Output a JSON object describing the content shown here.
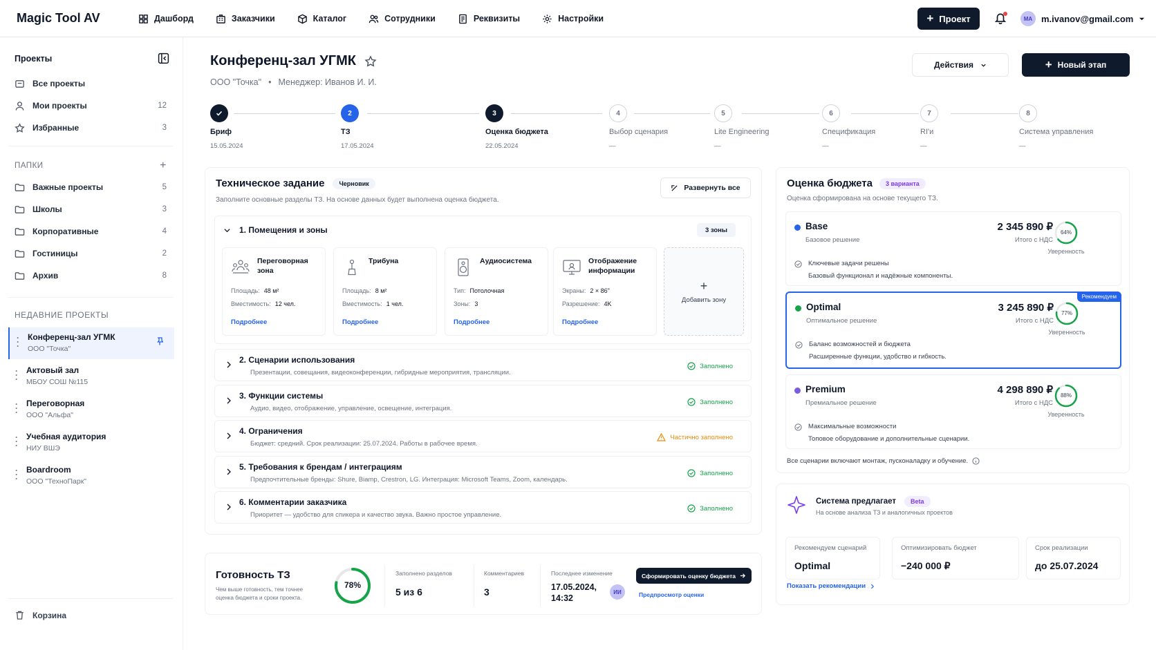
{
  "app": {
    "name": "Magic Tool AV"
  },
  "nav": [
    {
      "label": "Дашборд",
      "icon": "dashboard-icon"
    },
    {
      "label": "Заказчики",
      "icon": "building-icon"
    },
    {
      "label": "Каталог",
      "icon": "box-icon"
    },
    {
      "label": "Сотрудники",
      "icon": "users-icon"
    },
    {
      "label": "Реквизиты",
      "icon": "document-icon"
    },
    {
      "label": "Настройки",
      "icon": "gear-icon"
    }
  ],
  "header": {
    "project_button": "Проект",
    "user_initials": "MA",
    "user_email": "m.ivanov@gmail.com"
  },
  "sidebar": {
    "title": "Проекты",
    "items": [
      {
        "label": "Все проекты",
        "count": ""
      },
      {
        "label": "Мои проекты",
        "count": "12"
      },
      {
        "label": "Избранные",
        "count": "3"
      }
    ],
    "folders_title": "ПАПКИ",
    "folders": [
      {
        "label": "Важные проекты",
        "count": "5"
      },
      {
        "label": "Школы",
        "count": "3"
      },
      {
        "label": "Корпоративные",
        "count": "4"
      },
      {
        "label": "Гостиницы",
        "count": "2"
      },
      {
        "label": "Архив",
        "count": "8"
      }
    ],
    "recent_title": "НЕДАВНИЕ ПРОЕКТЫ",
    "recent": [
      {
        "title": "Конференц-зал УГМК",
        "sub": "ООО \"Точка\""
      },
      {
        "title": "Актовый зал",
        "sub": "МБОУ СОШ №115"
      },
      {
        "title": "Переговорная",
        "sub": "ООО \"Альфа\""
      },
      {
        "title": "Учебная аудитория",
        "sub": "НИУ ВШЭ"
      },
      {
        "title": "Boardroom",
        "sub": "ООО \"ТехноПарк\""
      }
    ],
    "trash": "Корзина"
  },
  "project": {
    "title": "Конференц-зал УГМК",
    "company": "ООО \"Точка\"",
    "separator": "•",
    "manager": "Менеджер: Иванов И. И.",
    "actions_label": "Действия",
    "new_stage_label": "Новый этап"
  },
  "steps": [
    {
      "num": "",
      "label": "Бриф",
      "date": "15.05.2024",
      "state": "done"
    },
    {
      "num": "2",
      "label": "ТЗ",
      "date": "17.05.2024",
      "state": "current"
    },
    {
      "num": "3",
      "label": "Оценка бюджета",
      "date": "22.05.2024",
      "state": "active"
    },
    {
      "num": "4",
      "label": "Выбор сценария",
      "date": "—",
      "state": "todo"
    },
    {
      "num": "5",
      "label": "Lite Engineering",
      "date": "—",
      "state": "todo"
    },
    {
      "num": "6",
      "label": "Спецификация",
      "date": "—",
      "state": "todo"
    },
    {
      "num": "7",
      "label": "RI'и",
      "date": "—",
      "state": "todo"
    },
    {
      "num": "8",
      "label": "Система управления",
      "date": "—",
      "state": "todo"
    }
  ],
  "tz": {
    "title": "Техническое задание",
    "badge": "Черновик",
    "desc": "Заполните основные разделы ТЗ. На основе данных будет выполнена оценка бюджета.",
    "expand_label": "Развернуть все",
    "zones_title": "1.  Помещения и зоны",
    "zones_count": "3 зоны",
    "zones": [
      {
        "title": "Переговорная зона",
        "k1": "Площадь:",
        "v1": "48 м²",
        "k2": "Вместимость:",
        "v2": "12 чел.",
        "more": "Подробнее"
      },
      {
        "title": "Трибуна",
        "k1": "Площадь:",
        "v1": "8 м²",
        "k2": "Вместимость:",
        "v2": "1 чел.",
        "more": "Подробнее"
      },
      {
        "title": "Аудиосистема",
        "k1": "Тип:",
        "v1": "Потолочная",
        "k2": "Зоны:",
        "v2": "3",
        "more": "Подробнее"
      },
      {
        "title": "Отображение информации",
        "k1": "Экраны:",
        "v1": "2 × 86\"",
        "k2": "Разрешение:",
        "v2": "4K",
        "more": "Подробнее"
      }
    ],
    "add_zone": "Добавить зону",
    "sections": [
      {
        "title": "2.  Сценарии использования",
        "desc": "Презентации, совещания, видеоконференции, гибридные мероприятия, трансляции.",
        "status": "Заполнено",
        "kind": "ok"
      },
      {
        "title": "3.  Функции системы",
        "desc": "Аудио, видео, отображение, управление, освещение, интеграция.",
        "status": "Заполнено",
        "kind": "ok"
      },
      {
        "title": "4.  Ограничения",
        "desc": "Бюджет: средний. Срок реализации: 25.07.2024. Работы в рабочее время.",
        "status": "Частично заполнено",
        "kind": "warn"
      },
      {
        "title": "5.  Требования к брендам / интеграциям",
        "desc": "Предпочтительные бренды: Shure, Biamp, Crestron, LG. Интеграция: Microsoft Teams, Zoom, календарь.",
        "status": "Заполнено",
        "kind": "ok"
      },
      {
        "title": "6.  Комментарии заказчика",
        "desc": "Приоритет — удобство для спикера и качество звука. Важно простое управление.",
        "status": "Заполнено",
        "kind": "ok"
      }
    ]
  },
  "readiness": {
    "title": "Готовность ТЗ",
    "desc1": "Чем выше готовность, тем точнее",
    "desc2": "оценка бюджета и сроки проекта.",
    "percent": 78,
    "percent_label": "78%",
    "sections_label": "Заполнено разделов",
    "sections_value": "5 из 6",
    "comments_label": "Комментариев",
    "comments_value": "3",
    "last_label": "Последнее изменение",
    "last_value1": "17.05.2024,",
    "last_value2": "14:32",
    "last_initials": "ИИ",
    "cta": "Сформировать оценку бюджета",
    "preview": "Предпросмотр оценки"
  },
  "budget": {
    "title": "Оценка бюджета",
    "badge": "3 варианта",
    "desc": "Оценка сформирована на основе текущего ТЗ.",
    "recommended": "Рекомендуем",
    "confidence_label": "Уверенность",
    "vat_label": "Итого с НДС",
    "variants": [
      {
        "name": "Base",
        "sub": "Базовое решение",
        "price": "2 345 890 ₽",
        "conf": 64,
        "conf_label": "64%",
        "f1": "Ключевые задачи решены",
        "f2": "Базовый функционал и надёжные компоненты.",
        "color": "#2563eb"
      },
      {
        "name": "Optimal",
        "sub": "Оптимальное решение",
        "price": "3 245 890 ₽",
        "conf": 77,
        "conf_label": "77%",
        "f1": "Баланс возможностей и бюджета",
        "f2": "Расширенные функции, удобство и гибкость.",
        "color": "#16a34a"
      },
      {
        "name": "Premium",
        "sub": "Премиальное решение",
        "price": "4 298 890 ₽",
        "conf": 88,
        "conf_label": "88%",
        "f1": "Максимальные возможности",
        "f2": "Топовое оборудование и дополнительные сценарии.",
        "color": "#7c5ce0"
      }
    ],
    "note": "Все сценарии включают монтаж, пусконаладку и обучение."
  },
  "suggest": {
    "title": "Система предлагает",
    "badge": "Beta",
    "desc": "На основе анализа ТЗ и аналогичных проектов",
    "boxes": [
      {
        "label": "Рекомендуем сценарий",
        "value": "Optimal"
      },
      {
        "label": "Оптимизировать бюджет",
        "value": "−240 000 ₽"
      },
      {
        "label": "Срок реализации",
        "value": "до 25.07.2024"
      }
    ],
    "link": "Показать рекомендации"
  },
  "colors": {
    "accent": "#2563eb",
    "dark": "#0f1b2d",
    "success": "#16a34a",
    "warning": "#ea8a0c"
  }
}
